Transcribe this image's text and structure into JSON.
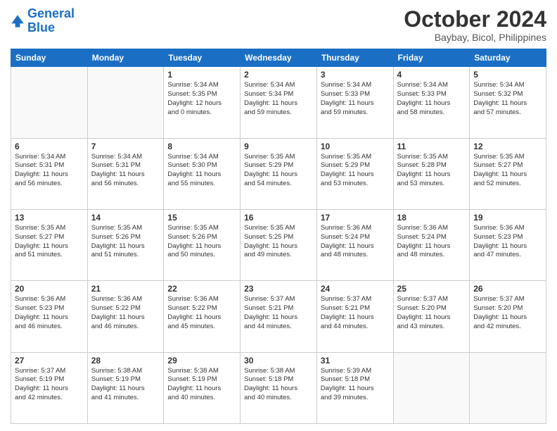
{
  "logo": {
    "line1": "General",
    "line2": "Blue"
  },
  "title": "October 2024",
  "subtitle": "Baybay, Bicol, Philippines",
  "headers": [
    "Sunday",
    "Monday",
    "Tuesday",
    "Wednesday",
    "Thursday",
    "Friday",
    "Saturday"
  ],
  "weeks": [
    [
      {
        "day": "",
        "text": ""
      },
      {
        "day": "",
        "text": ""
      },
      {
        "day": "1",
        "text": "Sunrise: 5:34 AM\nSunset: 5:35 PM\nDaylight: 12 hours\nand 0 minutes."
      },
      {
        "day": "2",
        "text": "Sunrise: 5:34 AM\nSunset: 5:34 PM\nDaylight: 11 hours\nand 59 minutes."
      },
      {
        "day": "3",
        "text": "Sunrise: 5:34 AM\nSunset: 5:33 PM\nDaylight: 11 hours\nand 59 minutes."
      },
      {
        "day": "4",
        "text": "Sunrise: 5:34 AM\nSunset: 5:33 PM\nDaylight: 11 hours\nand 58 minutes."
      },
      {
        "day": "5",
        "text": "Sunrise: 5:34 AM\nSunset: 5:32 PM\nDaylight: 11 hours\nand 57 minutes."
      }
    ],
    [
      {
        "day": "6",
        "text": "Sunrise: 5:34 AM\nSunset: 5:31 PM\nDaylight: 11 hours\nand 56 minutes."
      },
      {
        "day": "7",
        "text": "Sunrise: 5:34 AM\nSunset: 5:31 PM\nDaylight: 11 hours\nand 56 minutes."
      },
      {
        "day": "8",
        "text": "Sunrise: 5:34 AM\nSunset: 5:30 PM\nDaylight: 11 hours\nand 55 minutes."
      },
      {
        "day": "9",
        "text": "Sunrise: 5:35 AM\nSunset: 5:29 PM\nDaylight: 11 hours\nand 54 minutes."
      },
      {
        "day": "10",
        "text": "Sunrise: 5:35 AM\nSunset: 5:29 PM\nDaylight: 11 hours\nand 53 minutes."
      },
      {
        "day": "11",
        "text": "Sunrise: 5:35 AM\nSunset: 5:28 PM\nDaylight: 11 hours\nand 53 minutes."
      },
      {
        "day": "12",
        "text": "Sunrise: 5:35 AM\nSunset: 5:27 PM\nDaylight: 11 hours\nand 52 minutes."
      }
    ],
    [
      {
        "day": "13",
        "text": "Sunrise: 5:35 AM\nSunset: 5:27 PM\nDaylight: 11 hours\nand 51 minutes."
      },
      {
        "day": "14",
        "text": "Sunrise: 5:35 AM\nSunset: 5:26 PM\nDaylight: 11 hours\nand 51 minutes."
      },
      {
        "day": "15",
        "text": "Sunrise: 5:35 AM\nSunset: 5:26 PM\nDaylight: 11 hours\nand 50 minutes."
      },
      {
        "day": "16",
        "text": "Sunrise: 5:35 AM\nSunset: 5:25 PM\nDaylight: 11 hours\nand 49 minutes."
      },
      {
        "day": "17",
        "text": "Sunrise: 5:36 AM\nSunset: 5:24 PM\nDaylight: 11 hours\nand 48 minutes."
      },
      {
        "day": "18",
        "text": "Sunrise: 5:36 AM\nSunset: 5:24 PM\nDaylight: 11 hours\nand 48 minutes."
      },
      {
        "day": "19",
        "text": "Sunrise: 5:36 AM\nSunset: 5:23 PM\nDaylight: 11 hours\nand 47 minutes."
      }
    ],
    [
      {
        "day": "20",
        "text": "Sunrise: 5:36 AM\nSunset: 5:23 PM\nDaylight: 11 hours\nand 46 minutes."
      },
      {
        "day": "21",
        "text": "Sunrise: 5:36 AM\nSunset: 5:22 PM\nDaylight: 11 hours\nand 46 minutes."
      },
      {
        "day": "22",
        "text": "Sunrise: 5:36 AM\nSunset: 5:22 PM\nDaylight: 11 hours\nand 45 minutes."
      },
      {
        "day": "23",
        "text": "Sunrise: 5:37 AM\nSunset: 5:21 PM\nDaylight: 11 hours\nand 44 minutes."
      },
      {
        "day": "24",
        "text": "Sunrise: 5:37 AM\nSunset: 5:21 PM\nDaylight: 11 hours\nand 44 minutes."
      },
      {
        "day": "25",
        "text": "Sunrise: 5:37 AM\nSunset: 5:20 PM\nDaylight: 11 hours\nand 43 minutes."
      },
      {
        "day": "26",
        "text": "Sunrise: 5:37 AM\nSunset: 5:20 PM\nDaylight: 11 hours\nand 42 minutes."
      }
    ],
    [
      {
        "day": "27",
        "text": "Sunrise: 5:37 AM\nSunset: 5:19 PM\nDaylight: 11 hours\nand 42 minutes."
      },
      {
        "day": "28",
        "text": "Sunrise: 5:38 AM\nSunset: 5:19 PM\nDaylight: 11 hours\nand 41 minutes."
      },
      {
        "day": "29",
        "text": "Sunrise: 5:38 AM\nSunset: 5:19 PM\nDaylight: 11 hours\nand 40 minutes."
      },
      {
        "day": "30",
        "text": "Sunrise: 5:38 AM\nSunset: 5:18 PM\nDaylight: 11 hours\nand 40 minutes."
      },
      {
        "day": "31",
        "text": "Sunrise: 5:39 AM\nSunset: 5:18 PM\nDaylight: 11 hours\nand 39 minutes."
      },
      {
        "day": "",
        "text": ""
      },
      {
        "day": "",
        "text": ""
      }
    ]
  ]
}
